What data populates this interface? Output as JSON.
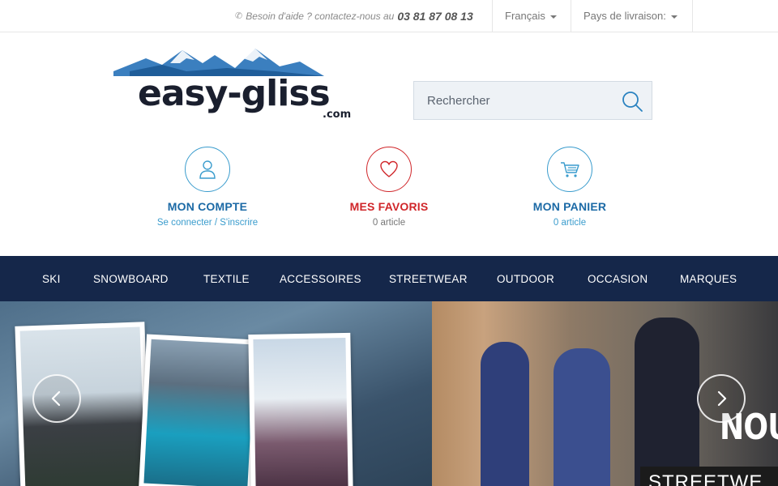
{
  "topbar": {
    "help_text": "Besoin d'aide ? contactez-nous au",
    "phone": "03 81 87 08 13",
    "language": "Français",
    "delivery_country": "Pays de livraison:"
  },
  "logo": {
    "brand": "easy-gliss",
    "suffix": ".com"
  },
  "search": {
    "placeholder": "Rechercher"
  },
  "account": {
    "title": "MON COMPTE",
    "link": "Se connecter / S'inscrire"
  },
  "favorites": {
    "title": "MES FAVORIS",
    "count": "0 article"
  },
  "cart": {
    "title": "MON PANIER",
    "count": "0 article"
  },
  "nav": {
    "items": [
      "SKI",
      "SNOWBOARD",
      "TEXTILE",
      "ACCESSOIRES",
      "STREETWEAR",
      "OUTDOOR",
      "OCCASION",
      "MARQUES"
    ]
  },
  "banner": {
    "headline": "NOU",
    "tag": "STREETWE"
  },
  "colors": {
    "nav_bg": "#15274a",
    "accent_blue": "#1c6aa6",
    "link_blue": "#3a9ccd",
    "fav_red": "#d0262a"
  }
}
